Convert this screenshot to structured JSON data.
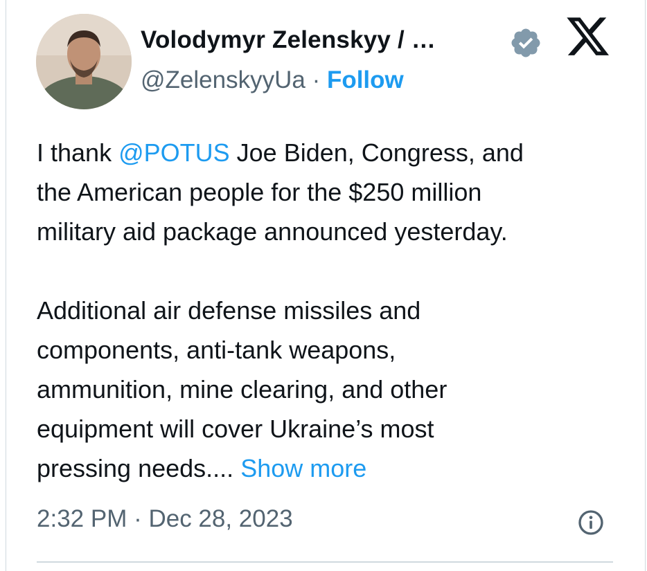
{
  "author": {
    "name": "Volodymyr Zelenskyy / …",
    "handle": "@ZelenskyyUa",
    "separator": "·",
    "follow_label": "Follow",
    "verified_icon": "verified-badge-icon",
    "avatar": "profile-photo"
  },
  "platform": {
    "logo": "x-logo-icon"
  },
  "tweet": {
    "p1_prefix": "I thank ",
    "mention": "@POTUS",
    "p1_line1_rest": " Joe Biden, Congress, and",
    "p1_line2": "the American people for the $250 million",
    "p1_line3": "military aid package announced yesterday.",
    "p2_line1": "Additional air defense missiles and",
    "p2_line2": "components, anti-tank weapons,",
    "p2_line3": "ammunition, mine clearing, and other",
    "p2_line4": "equipment will cover Ukraine’s most",
    "p2_line5": "pressing needs....",
    "show_more": "Show more"
  },
  "meta": {
    "timestamp": "2:32 PM · Dec 28, 2023",
    "info_icon": "info-icon"
  },
  "colors": {
    "accent": "#1d9bf0",
    "text": "#0f1419",
    "secondary": "#536471",
    "border": "#cfd9de",
    "verified": "#829aab"
  }
}
